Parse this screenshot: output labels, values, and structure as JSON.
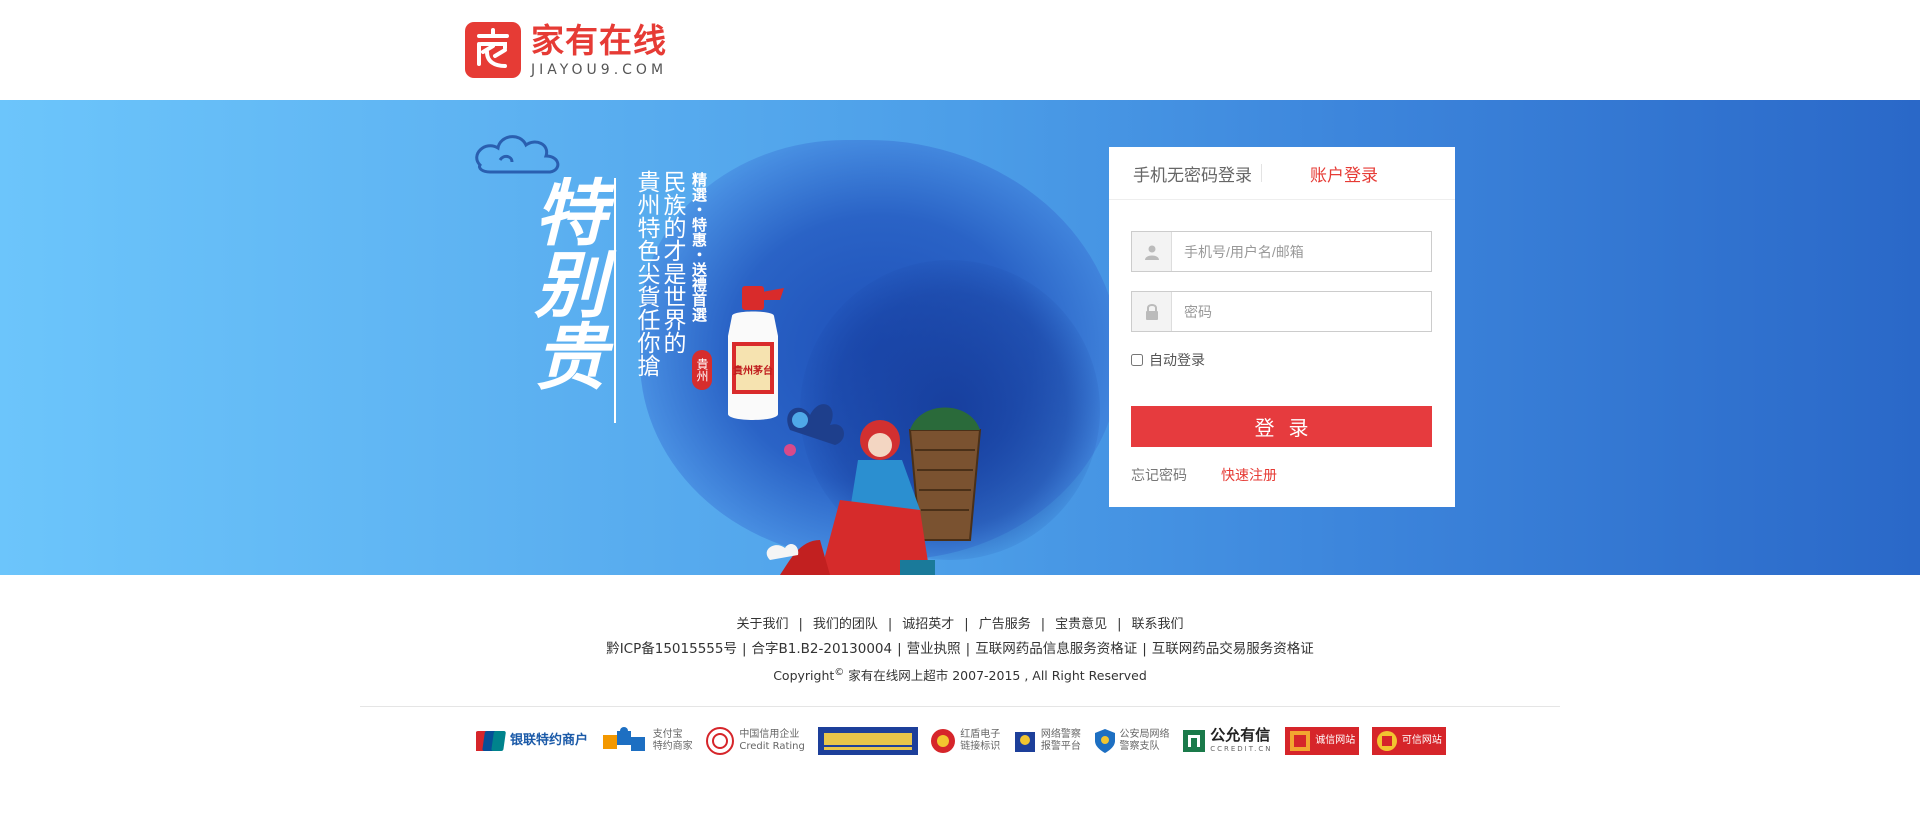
{
  "header": {
    "logo_cn": "家有在线",
    "logo_en": "JIAYOU9.COM",
    "colors": {
      "brand": "#e63b35"
    }
  },
  "banner": {
    "slogan_big": "特别贵",
    "slogan_col1": "民族的才是世界的",
    "slogan_col2": "貴州特色尖貨任你搶",
    "slogan_small": "精選・特惠・送禮首選",
    "seal": "貴州",
    "bottle_label": "貴州茅台"
  },
  "login": {
    "tab_sms": "手机无密码登录",
    "tab_account": "账户登录",
    "username_placeholder": "手机号/用户名/邮箱",
    "password_placeholder": "密码",
    "remember_label": "自动登录",
    "submit_label": "登录",
    "forgot_label": "忘记密码",
    "register_label": "快速注册"
  },
  "footer": {
    "nav": [
      "关于我们",
      "我们的团队",
      "诚招英才",
      "广告服务",
      "宝贵意见",
      "联系我们"
    ],
    "licenses": [
      "黔ICP备15015555号",
      "合字B1.B2-20130004",
      "营业执照",
      "互联网药品信息服务资格证",
      "互联网药品交易服务资格证"
    ],
    "copyright_prefix": "Copyright",
    "copyright_symbol": "©",
    "copyright_text": " 家有在线网上超市 2007-2015 , All Right Reserved",
    "badges": {
      "unionpay": "银联特约商户",
      "alipay_1": "支付宝",
      "alipay_2": "特约商家",
      "credit_1": "中国信用企业",
      "credit_2": "Credit Rating",
      "trust_1": "红盾电子",
      "trust_2": "链接标识",
      "police_1": "网络警察",
      "police_2": "报警平台",
      "psb_1": "公安局网络",
      "psb_2": "警察支队",
      "ccredit": "公允有信",
      "ccredit_sub": "CCREDIT.CN",
      "chengxin": "诚信网站",
      "kexin": "可信网站"
    }
  }
}
